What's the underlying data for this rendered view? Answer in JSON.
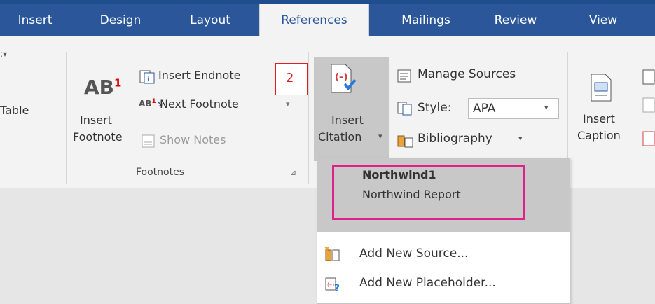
{
  "tabs": [
    {
      "label": "Insert"
    },
    {
      "label": "Design"
    },
    {
      "label": "Layout"
    },
    {
      "label": "References"
    },
    {
      "label": "Mailings"
    },
    {
      "label": "Review"
    },
    {
      "label": "View"
    }
  ],
  "left_partial": {
    "table_label": "Table"
  },
  "footnotes": {
    "insert_footnote_line1": "Insert",
    "insert_footnote_line2": "Footnote",
    "ab_label": "AB",
    "ab_sup": "1",
    "insert_endnote": "Insert Endnote",
    "next_footnote": "Next Footnote",
    "show_notes": "Show Notes",
    "group_label": "Footnotes"
  },
  "callout": {
    "number": "2"
  },
  "citations": {
    "insert_citation_line1": "Insert",
    "insert_citation_line2": "Citation",
    "manage_sources": "Manage Sources",
    "style_label": "Style:",
    "style_value": "APA",
    "bibliography": "Bibliography"
  },
  "captions": {
    "insert_caption_line1": "Insert",
    "insert_caption_line2": "Caption"
  },
  "menu": {
    "sources": [
      "Northwind1",
      "Northwind Report"
    ],
    "add_new_source": "Add New Source...",
    "add_new_placeholder": "Add New Placeholder..."
  },
  "colors": {
    "tab_bar": "#2b579a",
    "highlight": "#e0218a",
    "callout": "#e02020"
  }
}
